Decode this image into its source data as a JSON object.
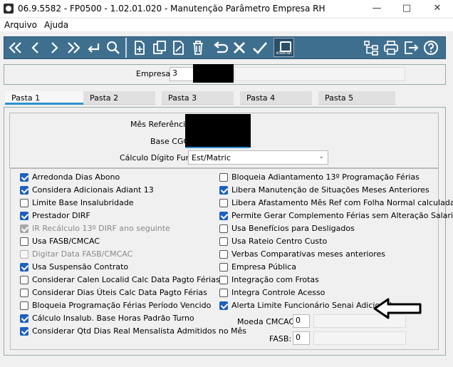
{
  "window": {
    "title": "06.9.5582 - FP0500 - 1.02.01.020 - Manutenção Parâmetro Empresa RH"
  },
  "menu": {
    "items": [
      "Arquivo",
      "Ajuda"
    ]
  },
  "toolbar": {
    "esocial_label": "eSocial"
  },
  "empresa": {
    "label": "Empresa:",
    "value": "3"
  },
  "tabs": [
    "Pasta 1",
    "Pasta 2",
    "Pasta 3",
    "Pasta 4",
    "Pasta 5"
  ],
  "form": {
    "mes_referencia_label": "Mês Referência:",
    "base_cgc_label": "Base CGC:",
    "calculo_digito_label": "Cálculo Dígito Func:",
    "calculo_digito_value": "Est/Matric",
    "moeda_cmcac_label": "Moeda CMCAC:",
    "moeda_cmcac_value": "0",
    "fasb_label": "FASB:",
    "fasb_value": "0"
  },
  "checkboxes_left": [
    {
      "label": "Arredonda Dias Abono",
      "checked": true,
      "disabled": false
    },
    {
      "label": "Considera Adicionais Adiant 13",
      "checked": true,
      "disabled": false
    },
    {
      "label": "Limite Base Insalubridade",
      "checked": false,
      "disabled": false
    },
    {
      "label": "Prestador DIRF",
      "checked": true,
      "disabled": false
    },
    {
      "label": "IR Recálculo 13º DIRF ano seguinte",
      "checked": true,
      "disabled": true
    },
    {
      "label": "Usa FASB/CMCAC",
      "checked": false,
      "disabled": false
    },
    {
      "label": "Digitar Data FASB/CMCAC",
      "checked": false,
      "disabled": true
    },
    {
      "label": "Usa Suspensão Contrato",
      "checked": true,
      "disabled": false
    },
    {
      "label": "Considerar Calen Localid Calc Data Pagto Férias",
      "checked": false,
      "disabled": false
    },
    {
      "label": "Considerar Dias Úteis Calc Data Pagto Férias",
      "checked": false,
      "disabled": false
    },
    {
      "label": "Bloqueia Programação Férias Período Vencido",
      "checked": false,
      "disabled": false
    },
    {
      "label": "Cálculo Insalub. Base Horas Padrão Turno",
      "checked": true,
      "disabled": false
    },
    {
      "label": "Considerar Qtd Dias Real Mensalista Admitidos no Mês",
      "checked": true,
      "disabled": false
    }
  ],
  "checkboxes_right": [
    {
      "label": "Bloqueia Adiantamento 13º Programação Férias",
      "checked": false,
      "disabled": false
    },
    {
      "label": "Libera Manutenção de Situações Meses Anteriores",
      "checked": true,
      "disabled": false
    },
    {
      "label": "Libera Afastamento Mês Ref com Folha Normal calculada",
      "checked": false,
      "disabled": false
    },
    {
      "label": "Permite Gerar Complemento Férias sem Alteração Salaria",
      "checked": true,
      "disabled": false
    },
    {
      "label": "Usa Benefícios para Desligados",
      "checked": false,
      "disabled": false
    },
    {
      "label": "Usa Rateio Centro Custo",
      "checked": false,
      "disabled": false
    },
    {
      "label": "Verbas Comparativas meses anteriores",
      "checked": false,
      "disabled": false
    },
    {
      "label": "Empresa Pública",
      "checked": false,
      "disabled": false
    },
    {
      "label": "Integração com Frotas",
      "checked": false,
      "disabled": false
    },
    {
      "label": "Integra Controle Acesso",
      "checked": false,
      "disabled": false
    },
    {
      "label": "Alerta Limite Funcionário Senai Adicional",
      "checked": true,
      "disabled": false
    }
  ]
}
